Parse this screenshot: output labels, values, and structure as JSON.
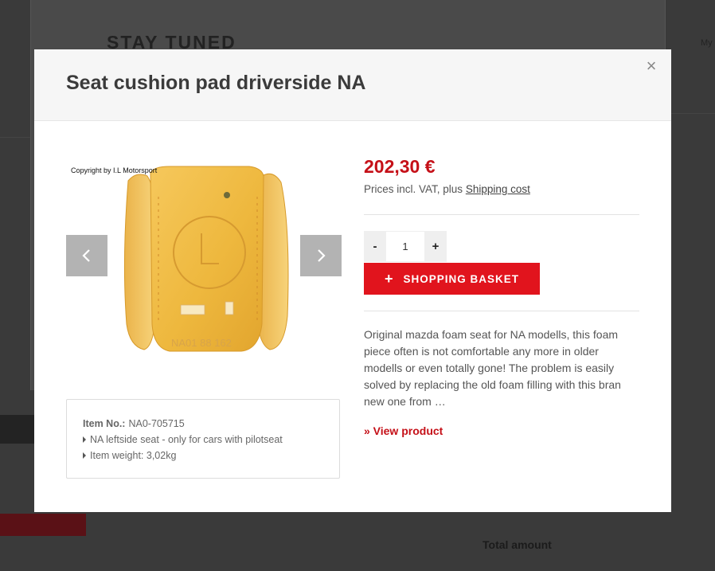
{
  "background": {
    "heading": "STAY TUNED",
    "corner_text": "My",
    "total_label": "Total amount"
  },
  "modal": {
    "title": "Seat cushion pad driverside NA",
    "close_symbol": "×"
  },
  "gallery": {
    "copyright": "Copyright by I.L Motorsport",
    "prev_icon": "chevron-left-icon",
    "next_icon": "chevron-right-icon",
    "image_text": "NA01 88 162"
  },
  "info": {
    "item_no_label": "Item No.:",
    "item_no": "NA0-705715",
    "bullets": [
      "NA leftside seat - only for cars with pilotseat",
      "Item weight: 3,02kg"
    ]
  },
  "product": {
    "price": "202,30 €",
    "vat_text": "Prices incl. VAT, plus",
    "shipping_link": "Shipping cost",
    "qty_minus": "-",
    "qty_value": "1",
    "qty_plus": "+",
    "basket_icon": "+",
    "basket_label": "SHOPPING BASKET",
    "description": "Original mazda foam seat for NA modells, this foam piece often is not comfortable any more in older modells or even totally gone! The problem is easily solved by replacing the old foam filling with this bran new one from …",
    "view_link": "» View product"
  },
  "colors": {
    "accent_red": "#e1141d",
    "price_red": "#c51018",
    "overlay": "#3a3a3a"
  }
}
